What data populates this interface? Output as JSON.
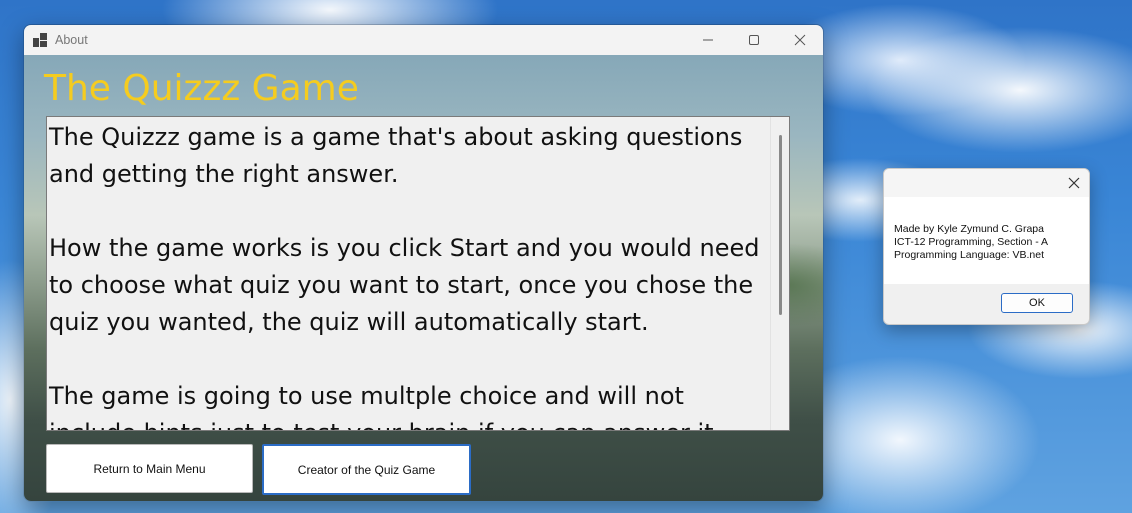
{
  "main_window": {
    "title": "About",
    "heading": "The Quizzz Game",
    "description_paragraphs": [
      "The Quizzz game is a game that's about asking questions and getting the right answer.",
      "How the game works is you click Start and you would need to choose what quiz you want to start, once you chose the quiz you wanted, the quiz will automatically start.",
      "The game is going to use multple choice and will not include hints just to test your brain if you can answer it correct. If"
    ],
    "buttons": {
      "return_label": "Return to Main Menu",
      "creator_label": "Creator of the Quiz Game"
    },
    "colors": {
      "heading": "#f5cc1f",
      "focus_border": "#2b6cc6"
    }
  },
  "message_box": {
    "lines": [
      "Made by Kyle Zymund C. Grapa",
      "ICT-12 Programming, Section - A",
      "Programming Language: VB.net"
    ],
    "ok_label": "OK"
  },
  "icons": {
    "app": "app-window-icon",
    "minimize": "minimize-icon",
    "maximize": "maximize-icon",
    "close": "close-icon"
  }
}
